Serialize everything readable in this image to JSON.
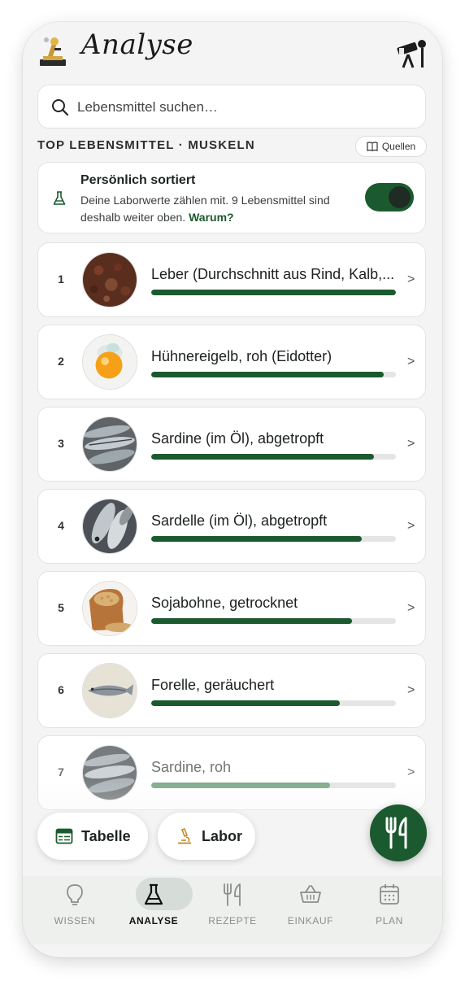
{
  "header": {
    "title": "Analyse",
    "logo_icon": "microscope-icon",
    "action_icon": "telescope-icon"
  },
  "search": {
    "placeholder": "Lebensmittel suchen…"
  },
  "section": {
    "title": "TOP LEBENSMITTEL · MUSKELN",
    "sources_label": "Quellen"
  },
  "personal": {
    "title": "Persönlich sortiert",
    "text": "Deine Laborwerte zählen mit. 9 Lebensmittel sind deshalb weiter oben.",
    "link": "Warum?",
    "toggle_on": true
  },
  "foods": [
    {
      "rank": "1",
      "name": "Leber (Durchschnitt aus Rind, Kalb,...",
      "score": 1.0
    },
    {
      "rank": "2",
      "name": "Hühnereigelb, roh (Eidotter)",
      "score": 0.95
    },
    {
      "rank": "3",
      "name": "Sardine (im Öl), abgetropft",
      "score": 0.91
    },
    {
      "rank": "4",
      "name": "Sardelle (im Öl), abgetropft",
      "score": 0.86
    },
    {
      "rank": "5",
      "name": "Sojabohne, getrocknet",
      "score": 0.82
    },
    {
      "rank": "6",
      "name": "Forelle, geräuchert",
      "score": 0.77
    },
    {
      "rank": "7",
      "name": "Sardine, roh",
      "score": 0.73
    }
  ],
  "quick_actions": {
    "table_label": "Tabelle",
    "lab_label": "Labor"
  },
  "nav": {
    "items": [
      {
        "label": "WISSEN",
        "icon": "lightbulb-icon"
      },
      {
        "label": "ANALYSE",
        "icon": "flask-icon"
      },
      {
        "label": "REZEPTE",
        "icon": "fork-knife-icon"
      },
      {
        "label": "EINKAUF",
        "icon": "basket-icon"
      },
      {
        "label": "PLAN",
        "icon": "calendar-icon"
      }
    ],
    "active": "ANALYSE"
  },
  "colors": {
    "accent": "#1b5a2e",
    "background": "#f3f4f3"
  }
}
